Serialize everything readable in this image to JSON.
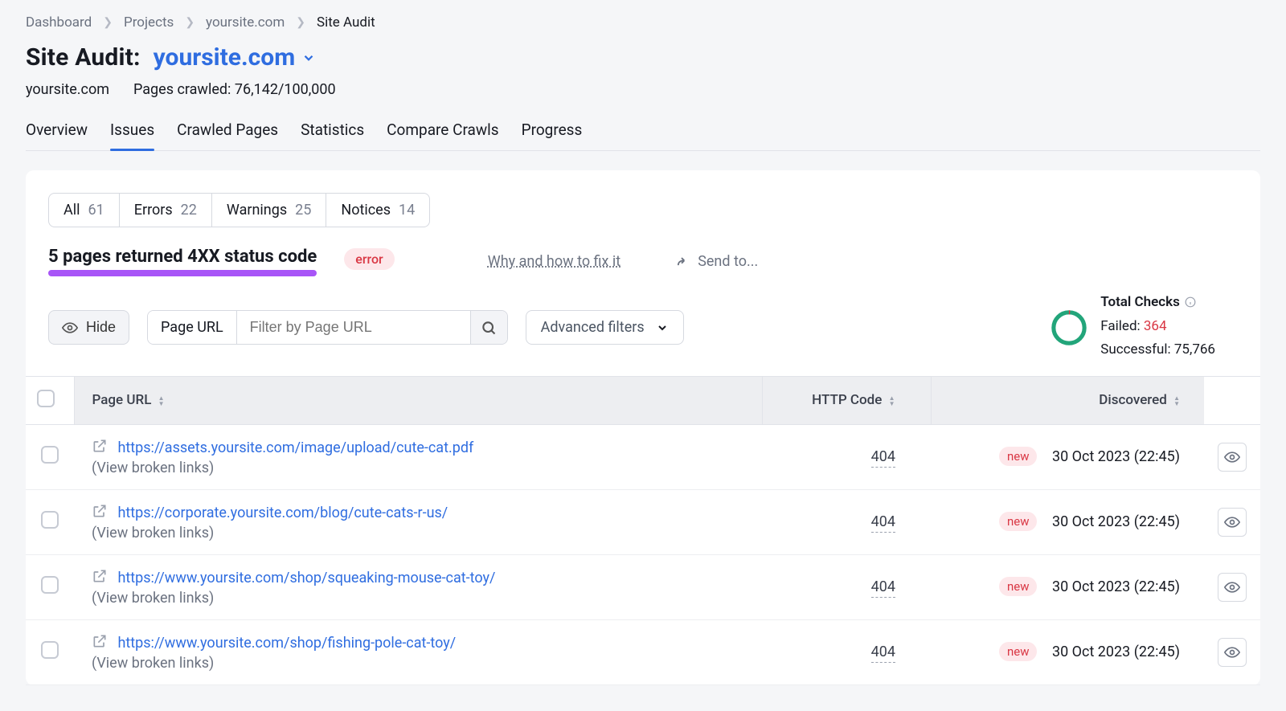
{
  "breadcrumb": [
    {
      "label": "Dashboard",
      "current": false
    },
    {
      "label": "Projects",
      "current": false
    },
    {
      "label": "yoursite.com",
      "current": false
    },
    {
      "label": "Site Audit",
      "current": true
    }
  ],
  "title": {
    "label": "Site Audit:",
    "domain": "yoursite.com"
  },
  "sub": {
    "domain": "yoursite.com",
    "crawled_label": "Pages crawled: 76,142/100,000"
  },
  "tabs": [
    {
      "label": "Overview",
      "active": false
    },
    {
      "label": "Issues",
      "active": true
    },
    {
      "label": "Crawled Pages",
      "active": false
    },
    {
      "label": "Statistics",
      "active": false
    },
    {
      "label": "Compare Crawls",
      "active": false
    },
    {
      "label": "Progress",
      "active": false
    }
  ],
  "segments": [
    {
      "label": "All",
      "count": "61"
    },
    {
      "label": "Errors",
      "count": "22"
    },
    {
      "label": "Warnings",
      "count": "25"
    },
    {
      "label": "Notices",
      "count": "14"
    }
  ],
  "issue": {
    "title": "5 pages returned 4XX status code",
    "badge": "error",
    "fix_link": "Why and how to fix it",
    "send_to": "Send to..."
  },
  "toolbar": {
    "hide_label": "Hide",
    "page_url_label": "Page URL",
    "filter_placeholder": "Filter by Page URL",
    "advanced_label": "Advanced filters"
  },
  "total_checks": {
    "label": "Total Checks",
    "failed_label": "Failed: ",
    "failed_value": "364",
    "success_label": "Successful: ",
    "success_value": "75,766"
  },
  "columns": {
    "url": "Page URL",
    "http": "HTTP Code",
    "discovered": "Discovered"
  },
  "view_broken": "(View broken links)",
  "new_badge": "new",
  "rows": [
    {
      "url": "https://assets.yoursite.com/image/upload/cute-cat.pdf",
      "http": "404",
      "discovered": "30 Oct 2023 (22:45)"
    },
    {
      "url": "https://corporate.yoursite.com/blog/cute-cats-r-us/",
      "http": "404",
      "discovered": "30 Oct 2023 (22:45)"
    },
    {
      "url": "https://www.yoursite.com/shop/squeaking-mouse-cat-toy/",
      "http": "404",
      "discovered": "30 Oct 2023 (22:45)"
    },
    {
      "url": "https://www.yoursite.com/shop/fishing-pole-cat-toy/",
      "http": "404",
      "discovered": "30 Oct 2023 (22:45)"
    }
  ]
}
